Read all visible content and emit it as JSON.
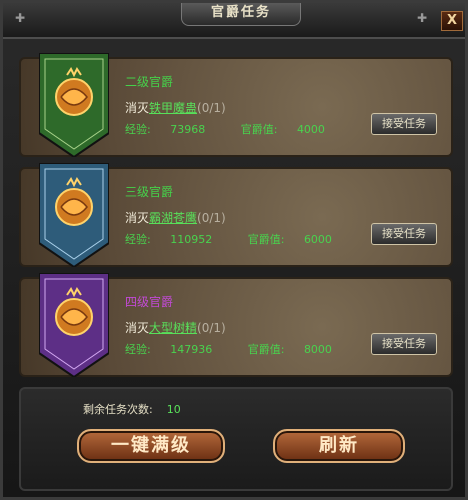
{
  "window": {
    "title": "官爵任务",
    "close_label": "X"
  },
  "cards": [
    {
      "rank": "二级官爵",
      "rank_color": "#45d24a",
      "banner_color": "#2e6a2a",
      "quest_prefix": "消灭",
      "quest_target": "铁甲魔蛊",
      "quest_count": "(0/1)",
      "exp_label": "经验:",
      "exp": "73968",
      "rank_value_label": "官爵值:",
      "rank_value": "4000",
      "button": "接受任务",
      "icon": "dragon-emblem-icon"
    },
    {
      "rank": "三级官爵",
      "rank_color": "#45d24a",
      "banner_color": "#2e5c7a",
      "quest_prefix": "消灭",
      "quest_target": "霸湖苍鹰",
      "quest_count": "(0/1)",
      "exp_label": "经验:",
      "exp": "110952",
      "rank_value_label": "官爵值:",
      "rank_value": "6000",
      "button": "接受任务",
      "icon": "dragon-emblem-icon"
    },
    {
      "rank": "四级官爵",
      "rank_color": "#c24ad6",
      "banner_color": "#5d2f86",
      "quest_prefix": "消灭",
      "quest_target": "大型树精",
      "quest_count": "(0/1)",
      "exp_label": "经验:",
      "exp": "147936",
      "rank_value_label": "官爵值:",
      "rank_value": "8000",
      "button": "接受任务",
      "icon": "dragon-emblem-icon"
    }
  ],
  "footer": {
    "remaining_label": "剩余任务次数:",
    "remaining_value": "10",
    "max_level_button": "一键满级",
    "refresh_button": "刷新"
  }
}
